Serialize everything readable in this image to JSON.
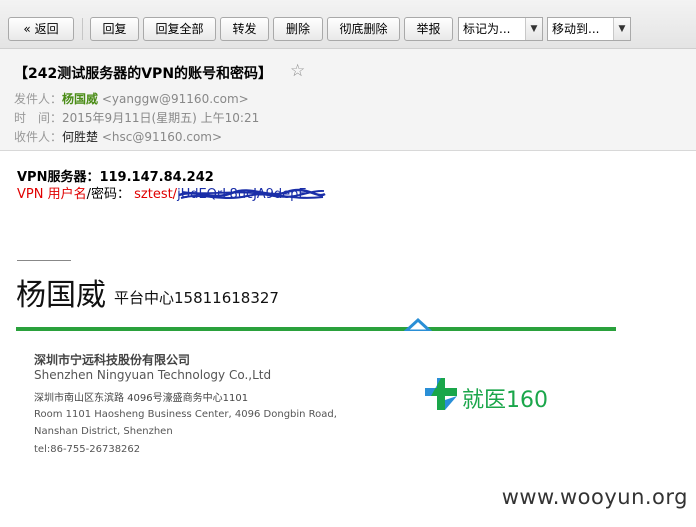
{
  "toolbar": {
    "back_label": "« 返回",
    "reply_label": "回复",
    "reply_all_label": "回复全部",
    "forward_label": "转发",
    "delete_label": "删除",
    "delete_perm_label": "彻底删除",
    "report_label": "举报",
    "mark_as_value": "标记为...",
    "move_to_value": "移动到..."
  },
  "email": {
    "subject": "【242测试服务器的VPN的账号和密码】",
    "from_label": "发件人：",
    "from_name": "杨国威",
    "from_addr": "<yanggw@91160.com>",
    "time_label": "时　间：",
    "time_value": "2015年9月11日(星期五) 上午10:21",
    "to_label": "收件人：",
    "to_name": "何胜楚",
    "to_addr": "<hsc@91160.com>"
  },
  "body": {
    "vpn_server_line": "VPN服务器：119.147.84.242",
    "vpn_user_label": "VPN 用户名",
    "vpn_pass_label": "/密码：",
    "vpn_user_value": "sztest/",
    "redacted_password": "jUdEQrL8ucJA9depE"
  },
  "signature": {
    "name": "杨国威",
    "title": "平台中心15811618327",
    "company_cn": "深圳市宁远科技股份有限公司",
    "company_en": "Shenzhen Ningyuan Technology Co.,Ltd",
    "address_cn": "深圳市南山区东滨路 4096号濠盛商务中心1101",
    "address_en_1": "Room 1101 Haosheng Business Center, 4096 Dongbin Road,",
    "address_en_2": "Nanshan District, Shenzhen",
    "tel": "tel:86-755-26738262",
    "logo_text": "就医160",
    "brand_color": "#2aa13c"
  },
  "watermark": "www.wooyun.org"
}
